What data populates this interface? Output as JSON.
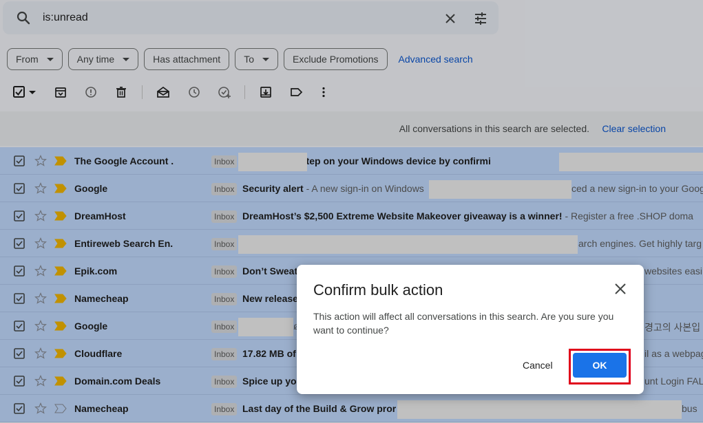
{
  "search": {
    "query": "is:unread"
  },
  "filters": {
    "chips": [
      {
        "label": "From",
        "dropdown": true
      },
      {
        "label": "Any time",
        "dropdown": true
      },
      {
        "label": "Has attachment",
        "dropdown": false
      },
      {
        "label": "To",
        "dropdown": true
      },
      {
        "label": "Exclude Promotions",
        "dropdown": false
      }
    ],
    "advanced_label": "Advanced search"
  },
  "toolbar": {
    "icons": [
      "select-all-checkbox-icon",
      "archive-icon",
      "report-spam-icon",
      "delete-icon",
      "mark-read-icon",
      "snooze-icon",
      "add-to-tasks-icon",
      "move-to-icon",
      "label-icon",
      "more-icon"
    ]
  },
  "banner": {
    "text": "All conversations in this search are selected.",
    "clear_label": "Clear selection"
  },
  "emails": [
    {
      "sender": "The Google Account .",
      "label": "Inbox",
      "subject": "ake the next step on your Windows device by confirmi",
      "snippet": "",
      "important": true
    },
    {
      "sender": "Google",
      "label": "Inbox",
      "subject": "Security alert",
      "snippet": " - A new sign-in on Windows",
      "important": true
    },
    {
      "sender": "DreamHost",
      "label": "Inbox",
      "subject": "DreamHost’s $2,500 Extreme Website Makeover giveaway is a winner!",
      "snippet": " - Register a free .SHOP doma",
      "important": true
    },
    {
      "sender": "Entireweb Search En.",
      "label": "Inbox",
      "subject": "",
      "snippet": "",
      "important": true
    },
    {
      "sender": "Epik.com",
      "label": "Inbox",
      "subject": "Don’t Sweat",
      "snippet": "",
      "important": true
    },
    {
      "sender": "Namecheap",
      "label": "Inbox",
      "subject": "New release",
      "snippet": "",
      "important": true
    },
    {
      "sender": "Google",
      "label": "Inbox",
      "subject": "",
      "snippet": "",
      "important": true
    },
    {
      "sender": "Cloudflare",
      "label": "Inbox",
      "subject": "17.82 MB of",
      "snippet": "",
      "important": true
    },
    {
      "sender": "Domain.com Deals",
      "label": "Inbox",
      "subject": "Spice up yo",
      "snippet": "",
      "important": true
    },
    {
      "sender": "Namecheap",
      "label": "Inbox",
      "subject": "Last day of the Build & Grow pror",
      "snippet": "",
      "important": false
    }
  ],
  "row_overflow": {
    "row0": "",
    "row1": "ced a new sign-in to your Goog",
    "row3": "arch engines. Get highly targ",
    "row4": "websites easi",
    "row6_a": "ø",
    "row6_b": "경고의 사본입",
    "row7": "il as a webpag",
    "row8": "unt Login FAL",
    "row9": "bus"
  },
  "dialog": {
    "title": "Confirm bulk action",
    "message": "This action will affect all conversations in this search. Are you sure you want to continue?",
    "cancel_label": "Cancel",
    "ok_label": "OK"
  },
  "colors": {
    "selected_row": "#c2dbff",
    "primary": "#1a73e8",
    "link": "#0b57d0",
    "highlight_box": "#e0001b",
    "important_marker": "#f2b600"
  }
}
